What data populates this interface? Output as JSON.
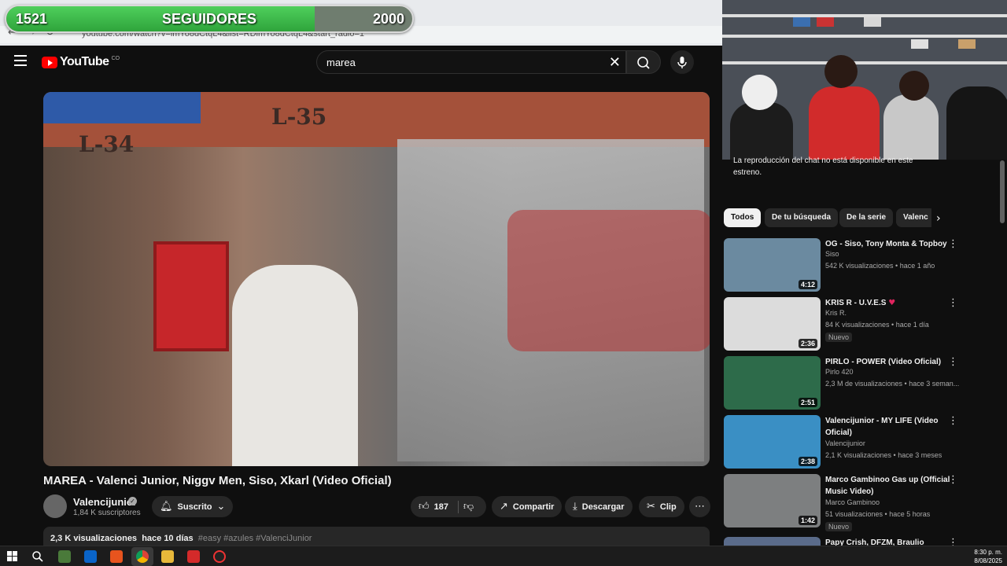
{
  "followers": {
    "current": "1521",
    "label": "SEGUIDORES",
    "goal": "2000",
    "progress": 0.7605
  },
  "browser": {
    "url": "youtube.com/watch?v=lmYo8dCtqL4&list=RDlmYo8dCtqL4&start_radio=1"
  },
  "header": {
    "logo": "YouTube",
    "country": "CO",
    "search_value": "marea"
  },
  "video": {
    "sign_left": "L-34",
    "sign_right": "L-35",
    "title": "MAREA - Valenci Junior, Niggv Men, Siso, Xkarl (Video Oficial)",
    "channel": "Valencijunior",
    "subscribers": "1,84 K suscriptores",
    "subscribe_label": "Suscrito",
    "likes": "187",
    "share_label": "Compartir",
    "download_label": "Descargar",
    "clip_label": "Clip",
    "views": "2,3 K visualizaciones",
    "age": "hace 10 días",
    "hashtags": "#easy #azules #ValenciJunior"
  },
  "chat_note": "La reproducción del chat no está disponible en este estreno.",
  "chips": [
    "Todos",
    "De tu búsqueda",
    "De la serie",
    "Valenc"
  ],
  "recommendations": [
    {
      "title": "OG - Siso, Tony Monta & Topboy",
      "channel": "Siso",
      "meta": "542 K visualizaciones • hace 1 año",
      "duration": "4:12",
      "badge": "",
      "thumb": "#6b8aa0"
    },
    {
      "title": "KRIS R - U.V.E.S",
      "channel": "Kris R.",
      "meta": "84 K visualizaciones • hace 1 día",
      "duration": "2:36",
      "badge": "Nuevo",
      "thumb": "#dcdcdc"
    },
    {
      "title": "PIRLO - POWER (Video Oficial)",
      "channel": "Pirlo 420",
      "meta": "2,3 M de visualizaciones • hace 3 seman...",
      "duration": "2:51",
      "badge": "",
      "thumb": "#2d6b4a"
    },
    {
      "title": "Valencijunior - MY LIFE (Video Oficial)",
      "channel": "Valencijunior",
      "meta": "2,1 K visualizaciones • hace 3 meses",
      "duration": "2:38",
      "badge": "",
      "thumb": "#3a8fc4"
    },
    {
      "title": "Marco Gambinoo Gas up (Official Music Video)",
      "channel": "Marco Gambinoo",
      "meta": "51 visualizaciones • hace 5 horas",
      "duration": "1:42",
      "badge": "Nuevo",
      "thumb": "#7d7f80"
    },
    {
      "title": "Papy Crish, DFZM, Braulio",
      "channel": "",
      "meta": "",
      "duration": "",
      "badge": "",
      "thumb": "#5a6b8a"
    }
  ],
  "clock": {
    "time": "8:30 p. m.",
    "date": "8/08/2025"
  }
}
